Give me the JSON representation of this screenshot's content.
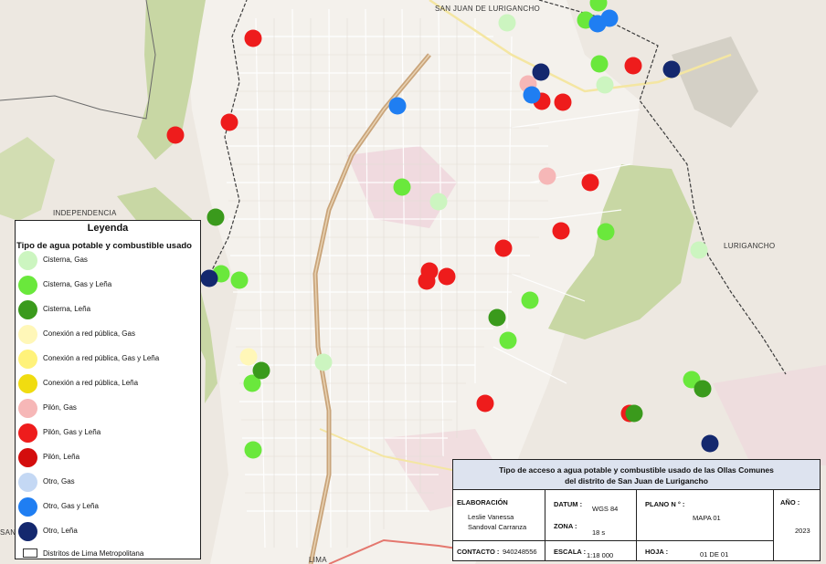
{
  "map": {
    "place_labels": [
      "SAN JUAN DE LURIGANCHO",
      "INDEPENDENCIA",
      "LURIGANCHO",
      "LIMA",
      "SAN"
    ],
    "colors": {
      "background": "#ede8e1",
      "hills": "#c8d7a4",
      "urban": "#f3f0ec",
      "pink_blocks": "#efd5dc",
      "main_road": "#c9a47a",
      "district_boundary": "#3c3c3c"
    },
    "points": [
      {
        "category": "Pilon, Gas y Lena"
      },
      {
        "category": "Pilon, Gas y Lena"
      },
      {
        "category": "Pilon, Gas y Lena"
      },
      {
        "category": "Pilon, Gas y Lena"
      },
      {
        "category": "Pilon, Gas y Lena"
      },
      {
        "category": "Pilon, Gas y Lena"
      },
      {
        "category": "Pilon, Gas y Lena"
      },
      {
        "category": "Pilon, Gas y Lena"
      },
      {
        "category": "Pilon, Gas y Lena"
      },
      {
        "category": "Pilon, Gas y Lena"
      },
      {
        "category": "Pilon, Gas y Lena"
      },
      {
        "category": "Pilon, Gas y Lena"
      },
      {
        "category": "Pilon, Gas y Lena"
      },
      {
        "category": "Pilon, Gas y Lena"
      },
      {
        "category": "Pilon, Gas"
      },
      {
        "category": "Pilon, Gas"
      },
      {
        "category": "Cisterna, Gas y Lena"
      },
      {
        "category": "Cisterna, Gas y Lena"
      },
      {
        "category": "Cisterna, Gas y Lena"
      },
      {
        "category": "Cisterna, Gas y Lena"
      },
      {
        "category": "Cisterna, Gas y Lena"
      },
      {
        "category": "Cisterna, Gas y Lena"
      },
      {
        "category": "Cisterna, Gas y Lena"
      },
      {
        "category": "Cisterna, Gas y Lena"
      },
      {
        "category": "Cisterna, Gas y Lena"
      },
      {
        "category": "Cisterna, Gas y Lena"
      },
      {
        "category": "Cisterna, Gas y Lena"
      },
      {
        "category": "Cisterna, Gas y Lena"
      },
      {
        "category": "Cisterna, Gas"
      },
      {
        "category": "Cisterna, Gas"
      },
      {
        "category": "Cisterna, Gas"
      },
      {
        "category": "Cisterna, Gas"
      },
      {
        "category": "Cisterna, Gas"
      },
      {
        "category": "Cisterna, Lena"
      },
      {
        "category": "Cisterna, Lena"
      },
      {
        "category": "Cisterna, Lena"
      },
      {
        "category": "Cisterna, Lena"
      },
      {
        "category": "Cisterna, Lena"
      },
      {
        "category": "Otro, Gas y Lena"
      },
      {
        "category": "Otro, Gas y Lena"
      },
      {
        "category": "Otro, Gas y Lena"
      },
      {
        "category": "Otro, Gas y Lena"
      },
      {
        "category": "Otro, Lena"
      },
      {
        "category": "Otro, Lena"
      },
      {
        "category": "Otro, Lena"
      },
      {
        "category": "Otro, Lena"
      },
      {
        "category": "Conexion a red publica, Gas"
      }
    ]
  },
  "legend": {
    "title": "Leyenda",
    "subtitle": "Tipo de agua potable y combustible usado",
    "items": [
      {
        "label": "Cisterna, Gas",
        "color": "#ccf5c0"
      },
      {
        "label": "Cisterna, Gas y Leña",
        "color": "#6ae83c"
      },
      {
        "label": "Cisterna, Leña",
        "color": "#3a9a1c"
      },
      {
        "label": "Conexión a red pública, Gas",
        "color": "#fff7b8"
      },
      {
        "label": "Conexión a red pública, Gas y Leña",
        "color": "#fff27a"
      },
      {
        "label": "Conexión a red pública, Leña",
        "color": "#f0dc10"
      },
      {
        "label": "Pilón, Gas",
        "color": "#f6b7b7"
      },
      {
        "label": "Pilón, Gas y Leña",
        "color": "#ee1c1c"
      },
      {
        "label": "Pilón, Leña",
        "color": "#d40d0d"
      },
      {
        "label": "Otro, Gas",
        "color": "#c4d8f4"
      },
      {
        "label": "Otro, Gas y Leña",
        "color": "#1f7ef2"
      },
      {
        "label": "Otro, Leña",
        "color": "#14286e"
      }
    ],
    "boundary_label": "Distritos de Lima Metropolitana"
  },
  "title_block": {
    "title_line1": "Tipo de acceso a agua potable y combustible usado de las Ollas Comunes",
    "title_line2": "del distrito de San Juan de Lurigancho",
    "elaboracion_label": "ELABORACIÓN",
    "elaboracion_value1": "Leslie Vanessa",
    "elaboracion_value2": "Sandoval Carranza",
    "datum_label": "DATUM :",
    "datum_value": "WGS 84",
    "zona_label": "ZONA :",
    "zona_value": "18 s",
    "plano_label": "PLANO N ° :",
    "plano_value": "MAPA 01",
    "anio_label": "AÑO :",
    "anio_value": "2023",
    "contacto_label": "CONTACTO :",
    "contacto_value": "940248556",
    "escala_label": "ESCALA :",
    "escala_value": "1:18 000",
    "hoja_label": "HOJA :",
    "hoja_value": "01 DE 01"
  }
}
